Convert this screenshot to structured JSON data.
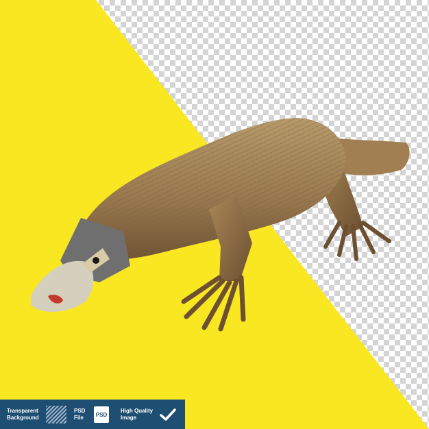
{
  "badge": {
    "transparent_label": "Transparent\nBackground",
    "psd_label": "PSD\nFile",
    "psd_icon_text": "PSD",
    "quality_label": "High Quality\nImage",
    "icons": [
      "diagonal-stripes-icon",
      "psd-file-icon",
      "checkmark-icon"
    ]
  },
  "colors": {
    "yellow": "#f9e721",
    "checker_light": "#ffffff",
    "checker_dark": "#d4d4d4",
    "badge_bg": "#1f4e73"
  }
}
